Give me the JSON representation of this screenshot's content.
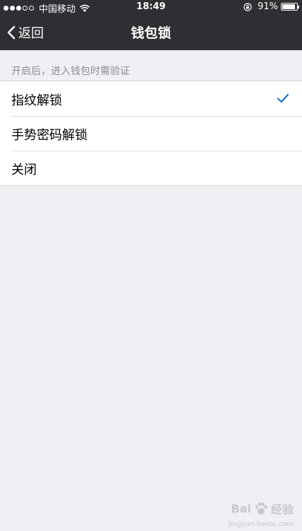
{
  "status_bar": {
    "signal_dots_full": 3,
    "signal_dots_total": 5,
    "carrier": "中国移动",
    "time": "18:49",
    "battery_percent": "91%",
    "battery_level": 0.91
  },
  "navbar": {
    "back_label": "返回",
    "title": "钱包锁"
  },
  "section": {
    "header": "开启后，进入钱包时需验证"
  },
  "options": [
    {
      "label": "指纹解锁",
      "selected": true
    },
    {
      "label": "手势密码解锁",
      "selected": false
    },
    {
      "label": "关闭",
      "selected": false
    }
  ],
  "colors": {
    "navbar_bg": "#2e2e33",
    "page_bg": "#efeff4",
    "check": "#1a73c9",
    "section_text": "#8e8e93"
  },
  "watermark": {
    "brand_left": "Bai",
    "brand_right": "经验",
    "url": "jingyan.baidu.com"
  }
}
